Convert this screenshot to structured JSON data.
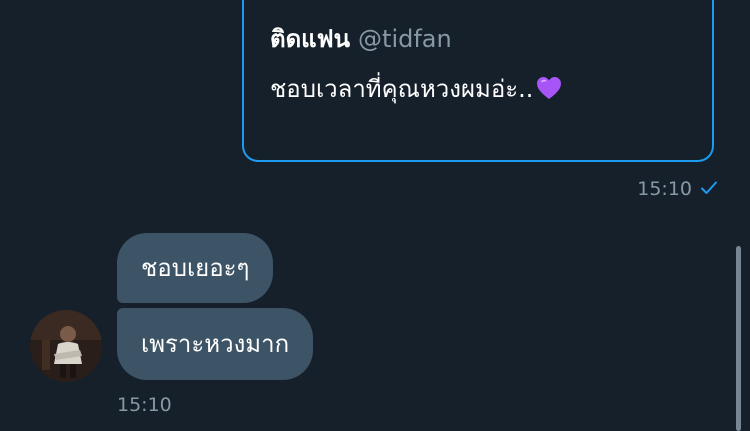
{
  "quote": {
    "name": "ติดแฟน",
    "handle": "@tidfan",
    "text": "ชอบเวลาที่คุณหวงผมอ่ะ..",
    "emoji_icon": "purple-heart-icon"
  },
  "sent_message": {
    "time": "15:10",
    "status_icon": "check-icon"
  },
  "received_messages": [
    {
      "text": "ชอบเยอะๆ"
    },
    {
      "text": "เพราะหวงมาก"
    }
  ],
  "received_time": "15:10",
  "colors": {
    "background": "#15202b",
    "accent": "#1d9bf0",
    "bubble": "#3d5466",
    "muted_text": "#8899a6",
    "heart": "#a855f7"
  }
}
